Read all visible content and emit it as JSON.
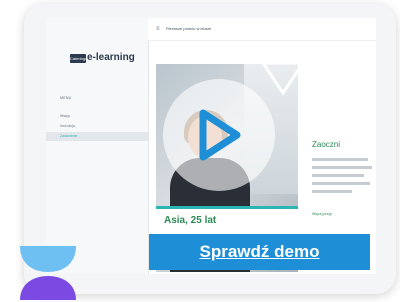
{
  "sidebar": {
    "logo_box": "Cateringowe",
    "logo_text": "e-learning",
    "menu_title": "MENU",
    "items": [
      {
        "label": "Wstęp",
        "active": false
      },
      {
        "label": "Instrukcja",
        "active": false
      },
      {
        "label": "Zadanienie",
        "active": true
      }
    ]
  },
  "topbar": {
    "title": "Pierwsze pomoc w biurze"
  },
  "content": {
    "section_label": "Zadanienie",
    "caption_name": "Asia, 25 lat",
    "right_title": "Zaoczni",
    "right_link": "Więcej przyp"
  },
  "cta": {
    "label": "Sprawdź demo"
  },
  "colors": {
    "cta": "#1e8fd6",
    "play": "#1e8fd6",
    "accent": "#29b6b4",
    "brand_top": "#6fc0f2",
    "brand_bottom": "#7b4ae2"
  },
  "icons": {
    "play": "play-icon",
    "menu": "hamburger-icon"
  }
}
